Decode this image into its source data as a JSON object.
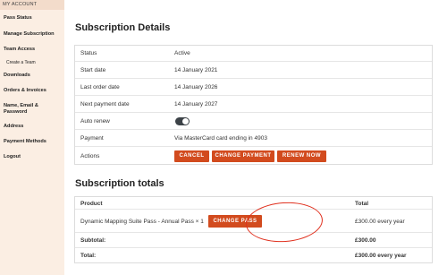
{
  "sidebar": {
    "header": "MY ACCOUNT",
    "items": [
      {
        "label": "Pass Status"
      },
      {
        "label": "Manage Subscription"
      },
      {
        "label": "Team Access"
      },
      {
        "label": "Create a Team"
      },
      {
        "label": "Downloads"
      },
      {
        "label": "Orders & Invoices"
      },
      {
        "label": "Name, Email & Password"
      },
      {
        "label": "Address"
      },
      {
        "label": "Payment Methods"
      },
      {
        "label": "Logout"
      }
    ]
  },
  "details": {
    "title": "Subscription Details",
    "rows": [
      {
        "label": "Status",
        "value": "Active"
      },
      {
        "label": "Start date",
        "value": "14 January 2021"
      },
      {
        "label": "Last order date",
        "value": "14 January 2026"
      },
      {
        "label": "Next payment date",
        "value": "14 January 2027"
      },
      {
        "label": "Auto renew",
        "value": ""
      },
      {
        "label": "Payment",
        "value": "Via MasterCard card ending in 4903"
      },
      {
        "label": "Actions",
        "value": ""
      }
    ],
    "auto_renew": true,
    "actions": {
      "cancel": "CANCEL",
      "change_payment": "CHANGE PAYMENT",
      "renew_now": "RENEW NOW"
    }
  },
  "totals": {
    "title": "Subscription totals",
    "col_product": "Product",
    "col_total": "Total",
    "product_name": "Dynamic Mapping Suite Pass - Annual Pass",
    "product_qty": "× 1",
    "product_total": "£300.00 every year",
    "change_pass": "CHANGE PASS",
    "subtotal_label": "Subtotal:",
    "subtotal_value": "£300.00",
    "total_label": "Total:",
    "total_value": "£300.00 every year"
  },
  "colors": {
    "accent": "#d24b1e",
    "sidebar_bg": "#fbeee3",
    "annotation": "#e0301e"
  }
}
